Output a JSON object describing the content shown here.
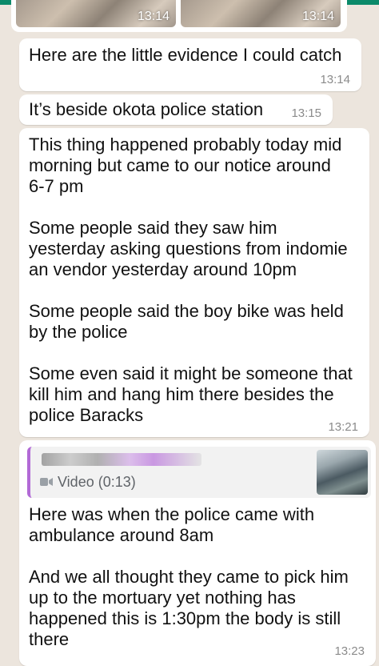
{
  "thumbnails": [
    {
      "time": "13:14"
    },
    {
      "time": "13:14"
    }
  ],
  "messages": [
    {
      "text": "Here are the little evidence I could catch",
      "time": "13:14"
    },
    {
      "text": "It’s beside okota police station",
      "time": "13:15"
    },
    {
      "text": "This thing happened probably today mid\nmorning but came to our notice around\n6-7 pm\n\nSome people said they saw him\nyesterday asking questions from indomie\nan vendor yesterday around 10pm\n\nSome people said the boy bike was held\nby the police\n\nSome even said it might be someone that\nkill him and hang him there besides the\npolice Baracks",
      "time": "13:21"
    },
    {
      "quoted": {
        "label": "Video (0:13)",
        "icon": "video-camera-icon"
      },
      "text": "Here was when the police came with\nambulance around 8am\n\nAnd we all thought they came to pick him\nup to the mortuary yet nothing has\nhappened this is 1:30pm the body is still\nthere",
      "time": "13:23"
    }
  ],
  "colors": {
    "chat_background": "#ece5dd",
    "bubble": "#ffffff",
    "quote_accent": "#b26ad6",
    "timestamp": "#8b8b8b"
  }
}
